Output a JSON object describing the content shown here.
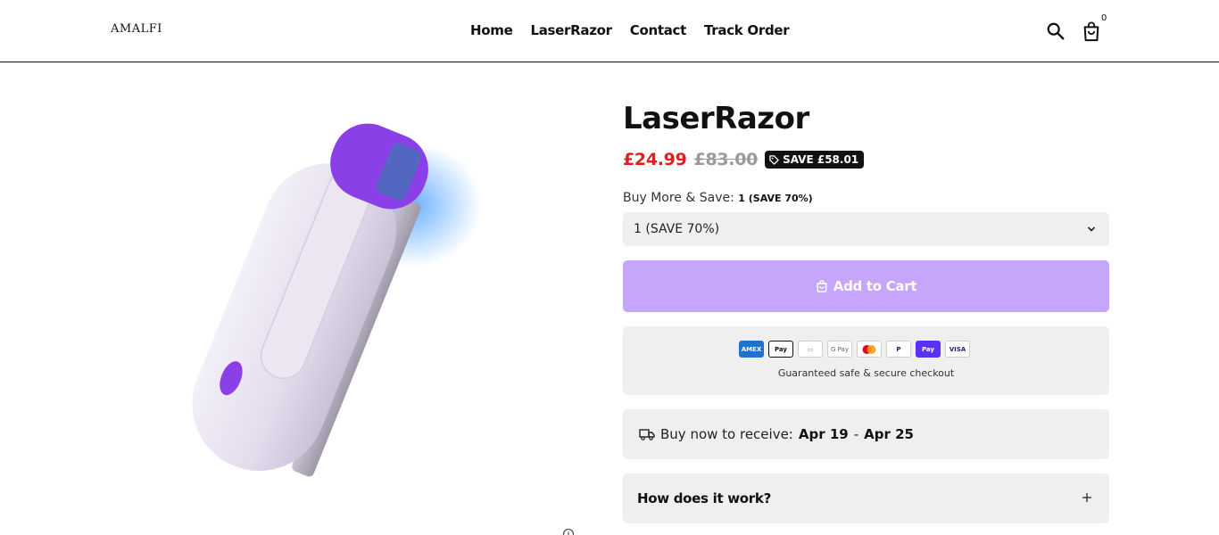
{
  "header": {
    "logo": "AMALFI",
    "nav": [
      "Home",
      "LaserRazor",
      "Contact",
      "Track Order"
    ],
    "cart_count": "0",
    "icons": [
      "search-icon",
      "cart-icon"
    ]
  },
  "product": {
    "title": "LaserRazor",
    "price": "£24.99",
    "compare_price": "£83.00",
    "save_badge": "SAVE £58.01",
    "bundle_label": "Buy More & Save:",
    "bundle_selected": "1 (SAVE 70%)",
    "select_value": "1 (SAVE 70%)",
    "add_to_cart": "Add to Cart",
    "payment_methods": [
      "AMEX",
      "Apple Pay",
      "Card",
      "G Pay",
      "Mastercard",
      "PayPal",
      "Shop Pay",
      "VISA"
    ],
    "secure_text": "Guaranteed safe & secure checkout",
    "delivery_prefix": "Buy now to receive:",
    "delivery_start": "Apr 19",
    "delivery_sep": "-",
    "delivery_end": "Apr 25",
    "faq_question": "How does it work?"
  },
  "colors": {
    "price_red": "#e11d1d",
    "accent_purple": "#c6a6fa",
    "panel_gray": "#efefef"
  }
}
